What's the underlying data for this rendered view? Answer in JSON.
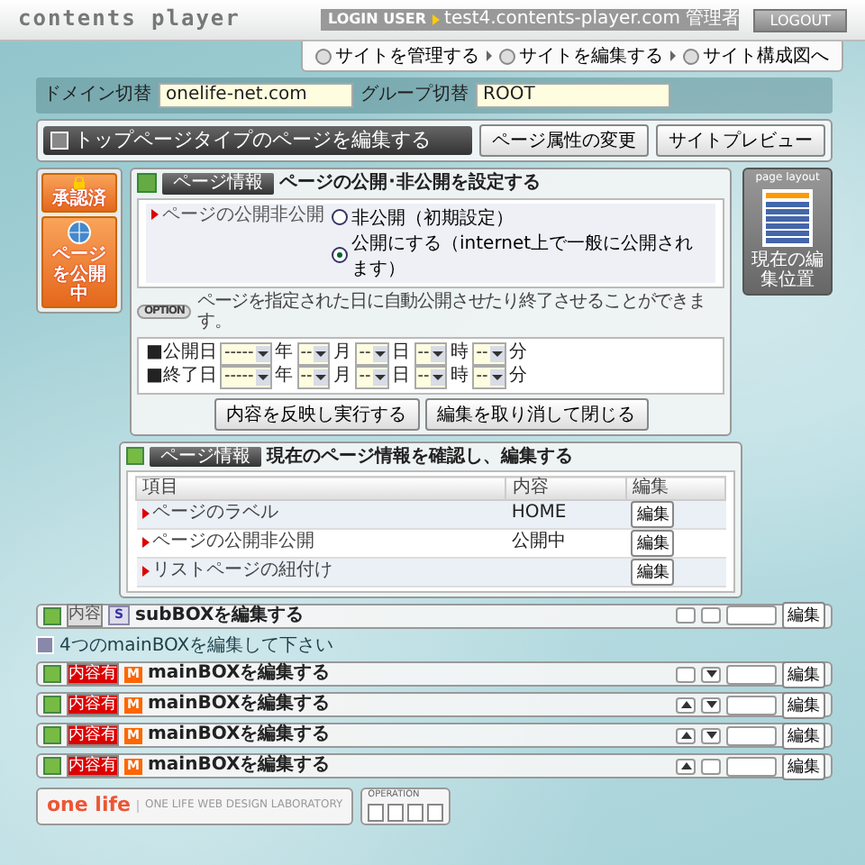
{
  "header": {
    "logo": "contents player",
    "login_label": "LOGIN USER",
    "login_user": "test4.contents-player.com 管理者",
    "logout": "LOGOUT"
  },
  "nav": [
    {
      "label": "サイトを管理する"
    },
    {
      "label": "サイトを編集する"
    },
    {
      "label": "サイト構成図へ"
    }
  ],
  "domain": {
    "label": "ドメイン切替",
    "value": "onelife-net.com"
  },
  "group": {
    "label": "グループ切替",
    "value": "ROOT"
  },
  "page_title": "トップページタイプのページを編集する",
  "page_buttons": [
    "ページ属性の変更",
    "サイトプレビュー"
  ],
  "badges": [
    {
      "kind": "approved",
      "label": "承認済"
    },
    {
      "kind": "published",
      "label": "ページを公開中"
    }
  ],
  "publish_panel": {
    "tag": "ページ情報",
    "title": "ページの公開･非公開を設定する",
    "field_label": "ページの公開非公開",
    "options": [
      {
        "label": "非公開（初期設定）",
        "selected": false
      },
      {
        "label": "公開にする（internet上で一般に公開されます）",
        "selected": true
      }
    ],
    "option_tag": "OPTION",
    "option_note": "ページを指定された日に自動公開させたり終了させることができます。",
    "date_rows": [
      {
        "label": "■公開日",
        "fields": [
          {
            "value": "-----",
            "unit": "年"
          },
          {
            "value": "--",
            "unit": "月"
          },
          {
            "value": "--",
            "unit": "日"
          },
          {
            "value": "--",
            "unit": "時"
          },
          {
            "value": "--",
            "unit": "分"
          }
        ]
      },
      {
        "label": "■終了日",
        "fields": [
          {
            "value": "-----",
            "unit": "年"
          },
          {
            "value": "--",
            "unit": "月"
          },
          {
            "value": "--",
            "unit": "日"
          },
          {
            "value": "--",
            "unit": "時"
          },
          {
            "value": "--",
            "unit": "分"
          }
        ]
      }
    ],
    "buttons": [
      "内容を反映し実行する",
      "編集を取り消して閉じる"
    ]
  },
  "layout_thumb": {
    "title": "page layout",
    "caption": "現在の編集位置"
  },
  "info_panel": {
    "tag": "ページ情報",
    "title": "現在のページ情報を確認し、編集する",
    "columns": [
      "項目",
      "内容",
      "編集"
    ],
    "rows": [
      {
        "item": "ページのラベル",
        "content": "HOME",
        "action": "編集"
      },
      {
        "item": "ページの公開非公開",
        "content": "公開中",
        "action": "編集"
      },
      {
        "item": "リストページの紐付け",
        "action": "編集"
      }
    ]
  },
  "sub_boxes": [
    {
      "tag": "内容",
      "has_content": false,
      "letter": "S",
      "label": "subBOXを編集する",
      "up": false,
      "down": false,
      "edit": "編集"
    }
  ],
  "main_note": "4つのmainBOXを編集して下さい",
  "main_boxes": [
    {
      "tag": "内容有",
      "has_content": true,
      "letter": "M",
      "label": "mainBOXを編集する",
      "up": false,
      "down": true,
      "edit": "編集"
    },
    {
      "tag": "内容有",
      "has_content": true,
      "letter": "M",
      "label": "mainBOXを編集する",
      "up": true,
      "down": true,
      "edit": "編集"
    },
    {
      "tag": "内容有",
      "has_content": true,
      "letter": "M",
      "label": "mainBOXを編集する",
      "up": true,
      "down": true,
      "edit": "編集"
    },
    {
      "tag": "内容有",
      "has_content": true,
      "letter": "M",
      "label": "mainBOXを編集する",
      "up": true,
      "down": false,
      "edit": "編集"
    }
  ],
  "footer": {
    "logo": "one life",
    "lab": "ONE LIFE WEB DESIGN LABORATORY",
    "operation": "OPERATION"
  }
}
